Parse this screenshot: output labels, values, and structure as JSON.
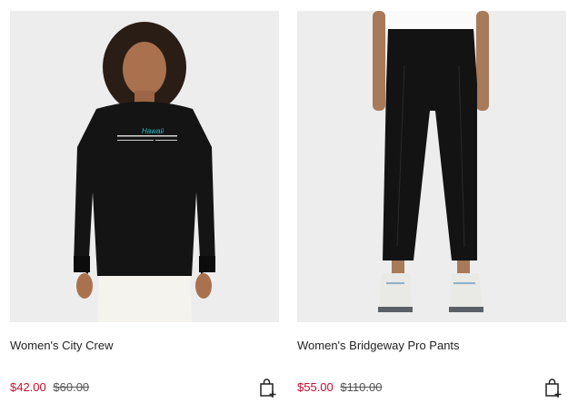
{
  "products": [
    {
      "name": "Women's City Crew",
      "sale_price": "$42.00",
      "original_price": "$60.00",
      "print_text": "Hawaii",
      "add_to_bag_icon": "shopping-bag-add-icon"
    },
    {
      "name": "Women's Bridgeway Pro Pants",
      "sale_price": "$55.00",
      "original_price": "$110.00",
      "add_to_bag_icon": "shopping-bag-add-icon"
    }
  ],
  "colors": {
    "sale": "#c8102e",
    "image_bg": "#ececec",
    "garment": "#111111"
  }
}
